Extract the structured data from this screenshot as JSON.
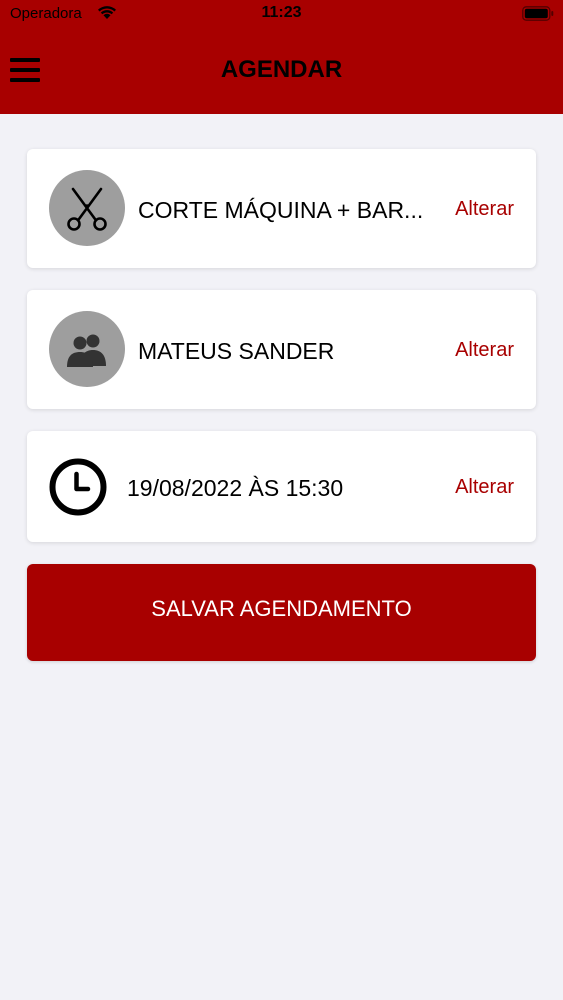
{
  "status_bar": {
    "carrier": "Operadora",
    "time": "11:23"
  },
  "header": {
    "title": "AGENDAR"
  },
  "service": {
    "label": "CORTE MÁQUINA + BAR...",
    "change_label": "Alterar",
    "icon": "scissors-icon"
  },
  "professional": {
    "label": "MATEUS SANDER",
    "change_label": "Alterar",
    "icon": "users-icon"
  },
  "datetime": {
    "label": "19/08/2022 ÀS 15:30",
    "change_label": "Alterar",
    "icon": "clock-icon"
  },
  "save_button": {
    "label": "SALVAR AGENDAMENTO"
  },
  "colors": {
    "brand": "#a80000",
    "background": "#f2f2f7",
    "card": "#ffffff",
    "avatar": "#9e9e9e"
  }
}
